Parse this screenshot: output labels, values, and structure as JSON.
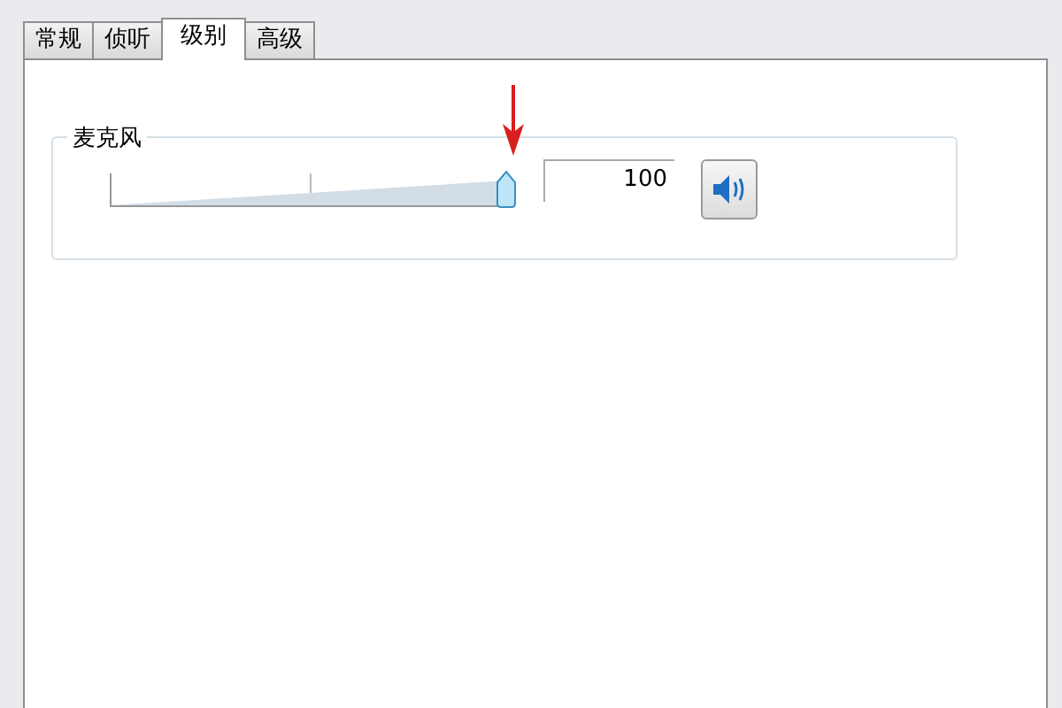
{
  "tabs": [
    {
      "label": "常规",
      "selected": false
    },
    {
      "label": "侦听",
      "selected": false
    },
    {
      "label": "级别",
      "selected": true
    },
    {
      "label": "高级",
      "selected": false
    }
  ],
  "microphone": {
    "label": "麦克风",
    "level": 1,
    "value": "100",
    "muted": false
  }
}
